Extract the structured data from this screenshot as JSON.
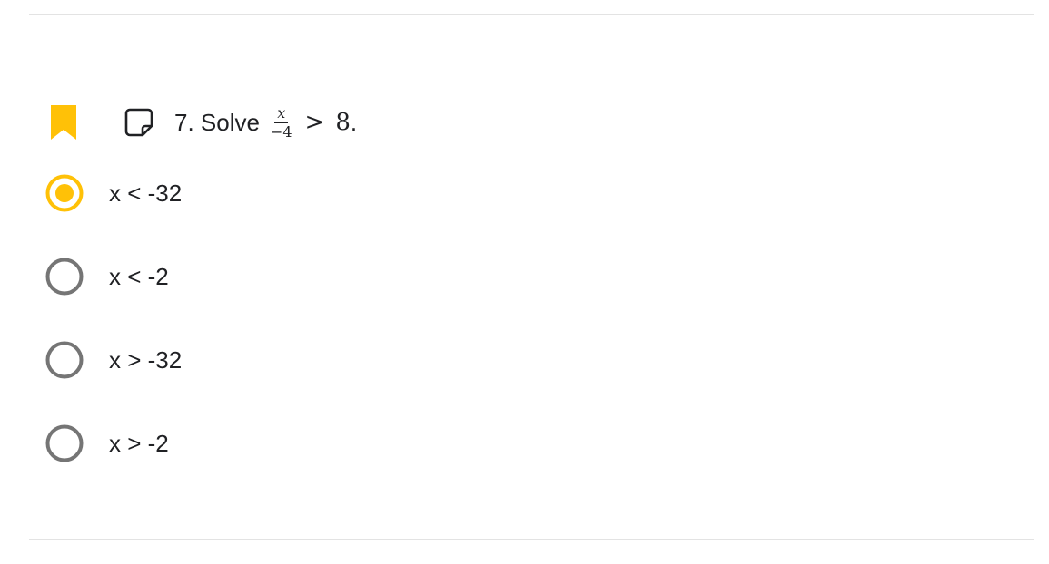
{
  "question": {
    "prefix": "7. Solve",
    "numerator": "x",
    "denominator": "−4",
    "relation": ">",
    "rhs": "8",
    "suffix": "."
  },
  "options": [
    {
      "label": "x < -32",
      "selected": true
    },
    {
      "label": "x < -2",
      "selected": false
    },
    {
      "label": "x > -32",
      "selected": false
    },
    {
      "label": "x > -2",
      "selected": false
    }
  ],
  "colors": {
    "accent": "#FFC107",
    "radio_unselected": "#757575",
    "divider": "#E3E3E3",
    "text": "#202124"
  },
  "icons": {
    "bookmark": "bookmark-icon",
    "note": "sticky-note-icon"
  }
}
